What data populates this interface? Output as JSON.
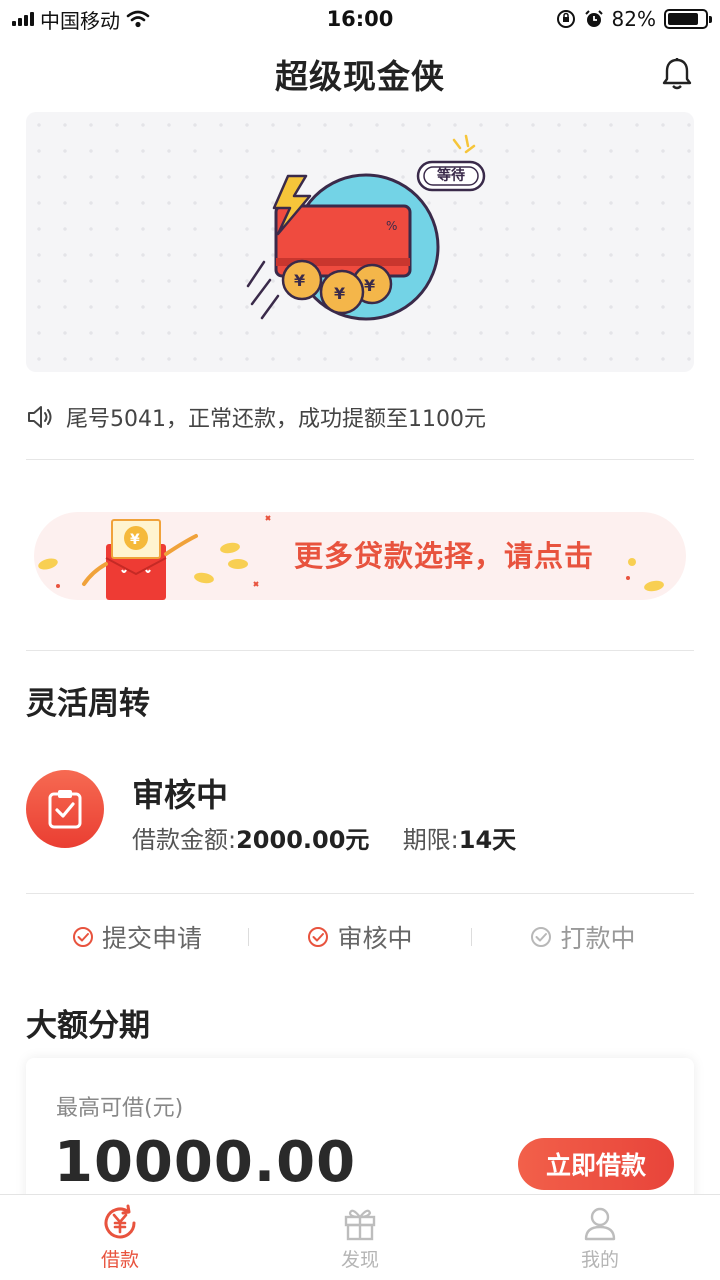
{
  "status_bar": {
    "carrier": "中国移动",
    "time": "16:00",
    "battery": "82%",
    "battery_level": 0.82
  },
  "header": {
    "title": "超级现金侠"
  },
  "banner": {
    "badge": "等待"
  },
  "notice": {
    "text": "尾号5041，正常还款，成功提额至1100元"
  },
  "promo": {
    "text": "更多贷款选择，请点击"
  },
  "flexible": {
    "section_title": "灵活周转",
    "status_title": "审核中",
    "amount_label": "借款金额:",
    "amount_value": "2000.00元",
    "term_label": "期限:",
    "term_value": "14天"
  },
  "steps": [
    {
      "label": "提交申请",
      "state": "done"
    },
    {
      "label": "审核中",
      "state": "done"
    },
    {
      "label": "打款中",
      "state": "pending"
    }
  ],
  "installment": {
    "section_title": "大额分期",
    "max_label": "最高可借(元)",
    "max_amount": "10000.00",
    "button_label": "立即借款"
  },
  "tabbar": [
    {
      "label": "借款",
      "icon": "yen-refresh-icon",
      "active": true
    },
    {
      "label": "发现",
      "icon": "gift-icon",
      "active": false
    },
    {
      "label": "我的",
      "icon": "user-icon",
      "active": false
    }
  ],
  "colors": {
    "accent": "#e8533e",
    "inactive": "#b5b5b5"
  }
}
